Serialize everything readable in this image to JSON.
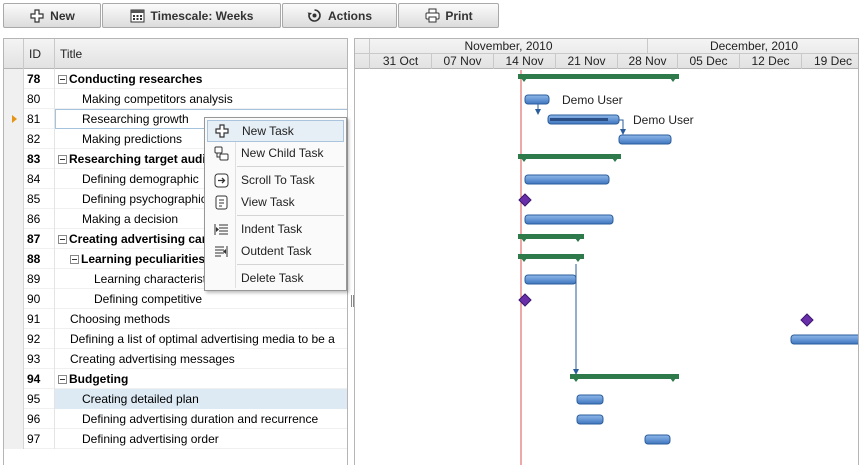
{
  "toolbar": {
    "new_label": "New",
    "timescale_label": "Timescale: Weeks",
    "actions_label": "Actions",
    "print_label": "Print"
  },
  "grid": {
    "col_id": "ID",
    "col_title": "Title",
    "rows": [
      {
        "id": "78",
        "title": "Conducting researches",
        "level": 0,
        "summary": true
      },
      {
        "id": "80",
        "title": "Making competitors analysis",
        "level": 1
      },
      {
        "id": "81",
        "title": "Researching growth",
        "level": 1,
        "focused": true
      },
      {
        "id": "82",
        "title": "Making predictions",
        "level": 1
      },
      {
        "id": "83",
        "title": "Researching target audience",
        "level": 0,
        "summary": true
      },
      {
        "id": "84",
        "title": "Defining demographic",
        "level": 1
      },
      {
        "id": "85",
        "title": "Defining psychographic",
        "level": 1
      },
      {
        "id": "86",
        "title": "Making a decision",
        "level": 1
      },
      {
        "id": "87",
        "title": "Creating advertising campaign",
        "level": 0,
        "summary": true
      },
      {
        "id": "88",
        "title": "Learning peculiarities",
        "level": 1,
        "summary": true
      },
      {
        "id": "89",
        "title": "Learning characteristics",
        "level": 2
      },
      {
        "id": "90",
        "title": "Defining competitive",
        "level": 2
      },
      {
        "id": "91",
        "title": "Choosing methods",
        "level": 0
      },
      {
        "id": "92",
        "title": "Defining a list of optimal advertising media to be a",
        "level": 0
      },
      {
        "id": "93",
        "title": "Creating advertising messages",
        "level": 0
      },
      {
        "id": "94",
        "title": "Budgeting",
        "level": 0,
        "summary": true
      },
      {
        "id": "95",
        "title": "Creating detailed plan",
        "level": 1,
        "selected": true
      },
      {
        "id": "96",
        "title": "Defining advertising duration and recurrence",
        "level": 1
      },
      {
        "id": "97",
        "title": "Defining advertising order",
        "level": 1
      }
    ]
  },
  "timeline": {
    "months": [
      "November, 2010",
      "December, 2010"
    ],
    "weeks": [
      "31 Oct",
      "07 Nov",
      "14 Nov",
      "21 Nov",
      "28 Nov",
      "05 Dec",
      "12 Dec",
      "19 Dec"
    ]
  },
  "assignments": {
    "a1": "Demo User",
    "a2": "Demo User"
  },
  "context_menu": {
    "items": [
      {
        "label": "New Task",
        "icon": "plus-icon"
      },
      {
        "label": "New Child Task",
        "icon": "child-task-icon"
      },
      {
        "label": "Scroll To Task",
        "icon": "scroll-to-icon"
      },
      {
        "label": "View Task",
        "icon": "view-task-icon"
      },
      {
        "label": "Indent Task",
        "icon": "indent-icon"
      },
      {
        "label": "Outdent Task",
        "icon": "outdent-icon"
      },
      {
        "label": "Delete Task",
        "icon": ""
      }
    ]
  },
  "colors": {
    "task_bar": "#5b8fd0",
    "summary_bar": "#2e7a4a",
    "milestone": "#6a2fa8",
    "today_line": "#d9534f"
  }
}
